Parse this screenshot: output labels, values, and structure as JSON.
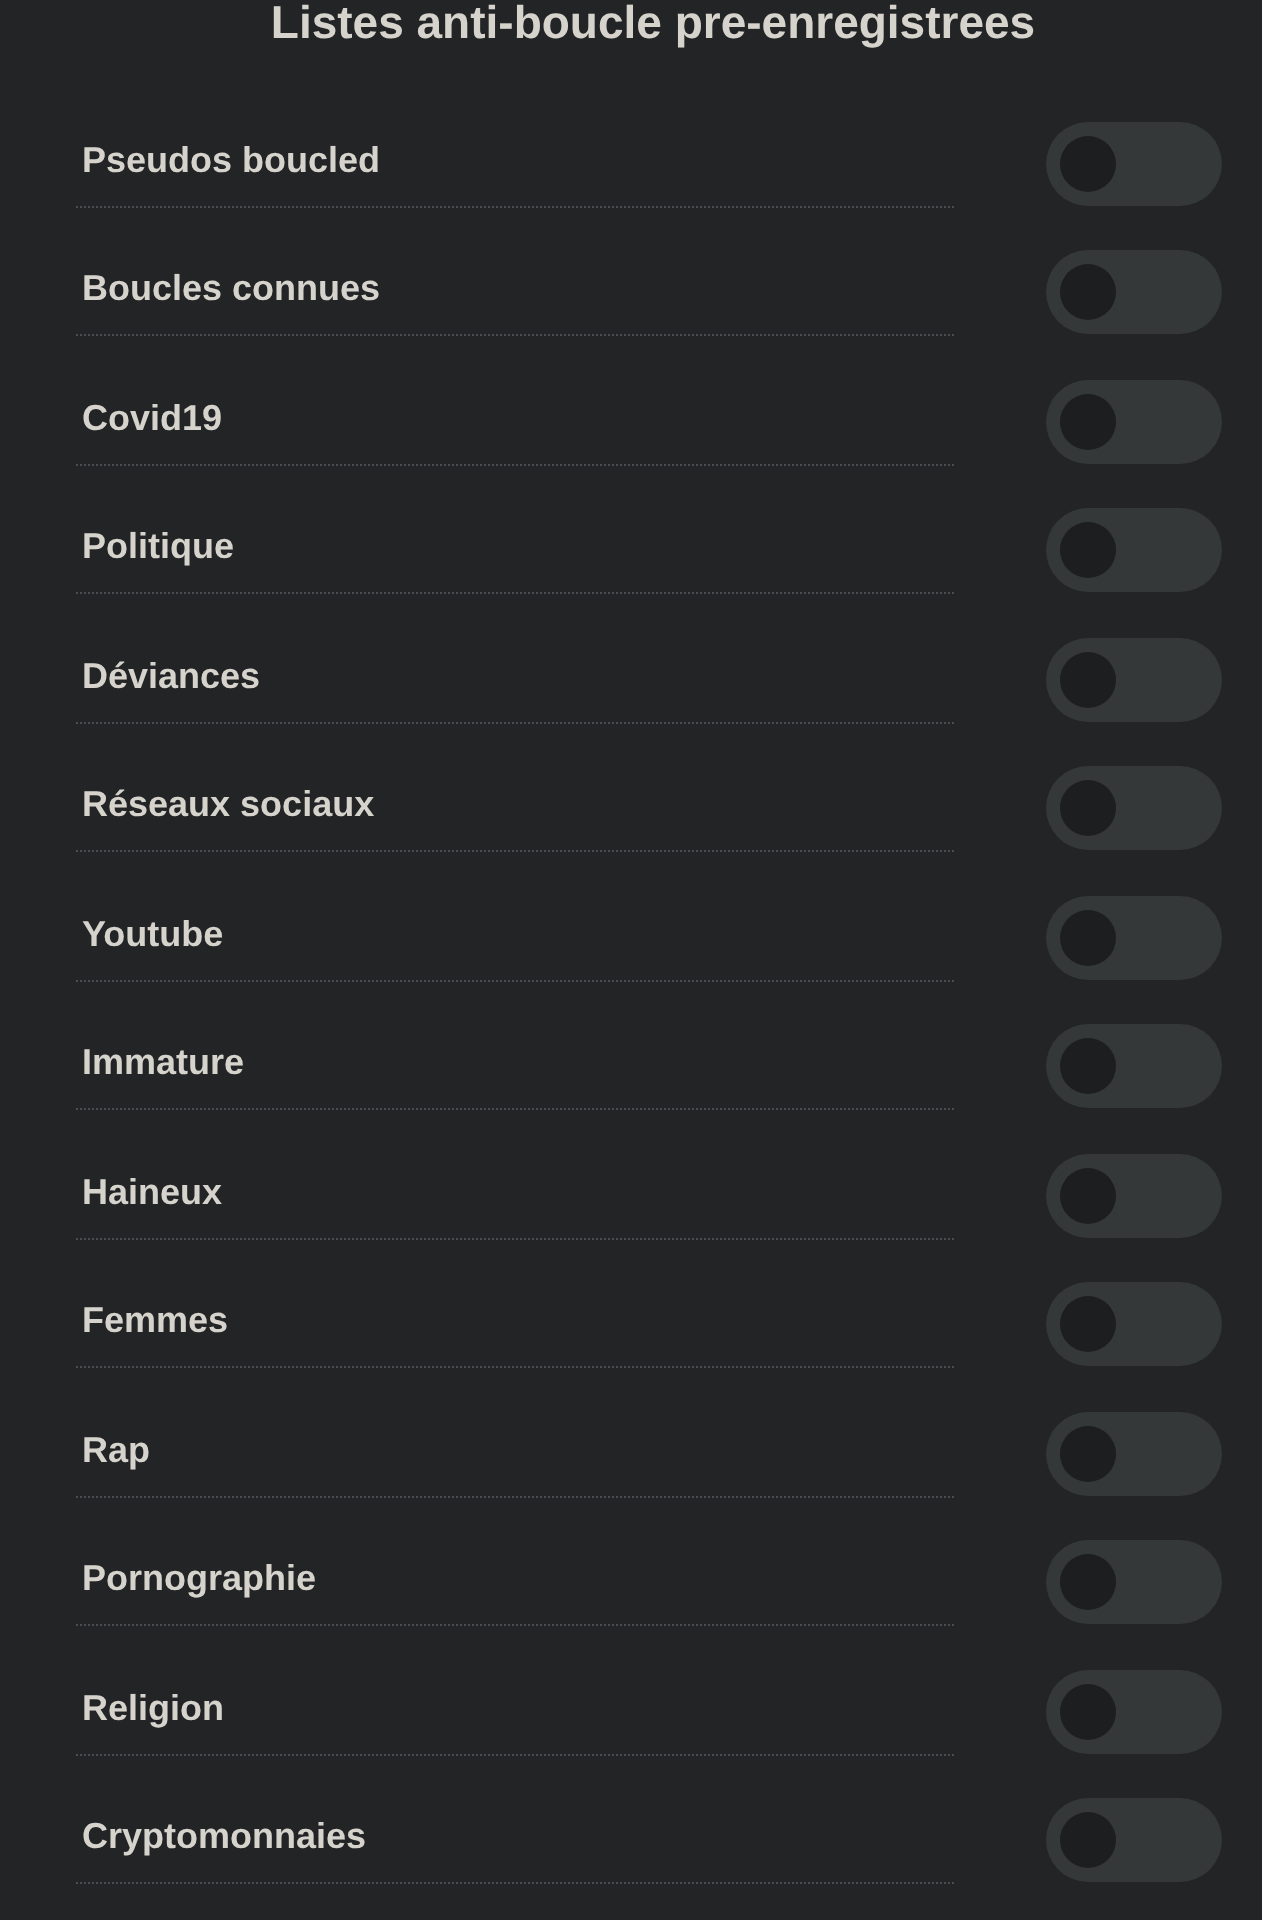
{
  "title": "Listes anti-boucle pre-enregistrees",
  "lists": [
    {
      "label": "Pseudos boucled",
      "on": false
    },
    {
      "label": "Boucles connues",
      "on": false
    },
    {
      "label": "Covid19",
      "on": false
    },
    {
      "label": "Politique",
      "on": false
    },
    {
      "label": "Déviances",
      "on": false
    },
    {
      "label": "Réseaux sociaux",
      "on": false
    },
    {
      "label": "Youtube",
      "on": false
    },
    {
      "label": "Immature",
      "on": false
    },
    {
      "label": "Haineux",
      "on": false
    },
    {
      "label": "Femmes",
      "on": false
    },
    {
      "label": "Rap",
      "on": false
    },
    {
      "label": "Pornographie",
      "on": false
    },
    {
      "label": "Religion",
      "on": false
    },
    {
      "label": "Cryptomonnaies",
      "on": false
    }
  ]
}
